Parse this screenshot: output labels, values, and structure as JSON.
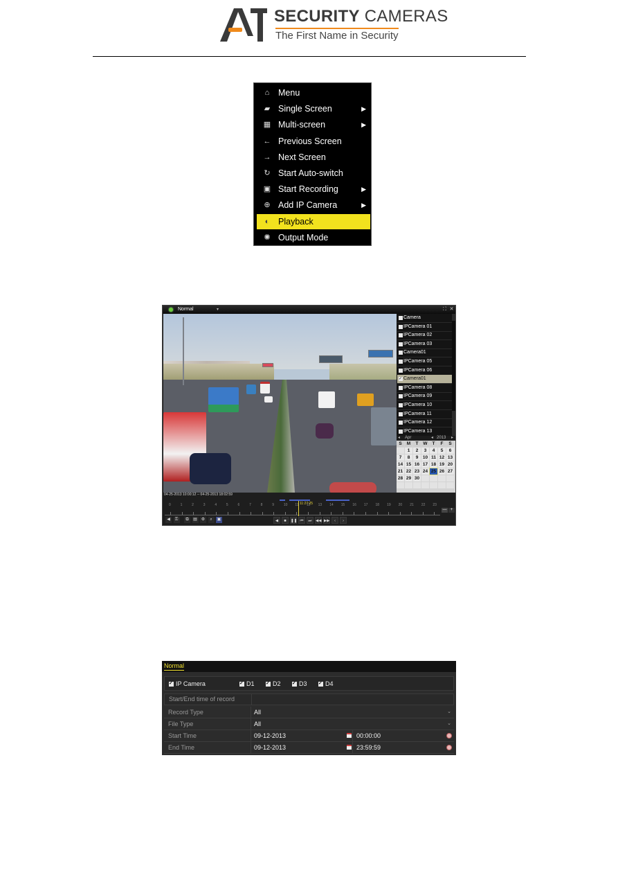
{
  "header": {
    "brand_a1": "A1",
    "brand_title_bold": "SECURITY",
    "brand_title_light": " CAMERAS",
    "tagline": "The First Name in Security",
    "accent_color": "#f08a1c"
  },
  "context_menu": {
    "items": [
      {
        "icon": "home-icon",
        "glyph": "⌂",
        "label": "Menu",
        "submenu": false,
        "selected": false
      },
      {
        "icon": "camera-icon",
        "glyph": "▰",
        "label": "Single Screen",
        "submenu": true,
        "selected": false
      },
      {
        "icon": "multi-screen-icon",
        "glyph": "▦",
        "label": "Multi-screen",
        "submenu": true,
        "selected": false
      },
      {
        "icon": "arrow-left-icon",
        "glyph": "←",
        "label": "Previous Screen",
        "submenu": false,
        "selected": false
      },
      {
        "icon": "arrow-right-icon",
        "glyph": "→",
        "label": "Next Screen",
        "submenu": false,
        "selected": false
      },
      {
        "icon": "refresh-icon",
        "glyph": "↻",
        "label": "Start Auto-switch",
        "submenu": false,
        "selected": false
      },
      {
        "icon": "record-icon",
        "glyph": "▣",
        "label": "Start Recording",
        "submenu": true,
        "selected": false
      },
      {
        "icon": "add-camera-icon",
        "glyph": "⊕",
        "label": "Add IP Camera",
        "submenu": true,
        "selected": false
      },
      {
        "icon": "playback-icon",
        "glyph": "◐",
        "label": "Playback",
        "submenu": false,
        "selected": true
      },
      {
        "icon": "output-mode-icon",
        "glyph": "✺",
        "label": "Output Mode",
        "submenu": false,
        "selected": false
      }
    ],
    "highlight_color": "#f2e21e"
  },
  "playback": {
    "mode": "Normal",
    "cameras": [
      {
        "name": "Camera",
        "checked": false,
        "selected": false
      },
      {
        "name": "IPCamera 01",
        "checked": false,
        "selected": false
      },
      {
        "name": "IPCamera 02",
        "checked": false,
        "selected": false
      },
      {
        "name": "IPCamera 03",
        "checked": false,
        "selected": false
      },
      {
        "name": "Camera01",
        "checked": false,
        "selected": false
      },
      {
        "name": "IPCamera 05",
        "checked": false,
        "selected": false
      },
      {
        "name": "IPCamera 06",
        "checked": false,
        "selected": false
      },
      {
        "name": "Camera01",
        "checked": true,
        "selected": true
      },
      {
        "name": "IPCamera 08",
        "checked": false,
        "selected": false
      },
      {
        "name": "IPCamera 09",
        "checked": false,
        "selected": false
      },
      {
        "name": "IPCamera 10",
        "checked": false,
        "selected": false
      },
      {
        "name": "IPCamera 11",
        "checked": false,
        "selected": false
      },
      {
        "name": "IPCamera 12",
        "checked": false,
        "selected": false
      },
      {
        "name": "IPCamera 13",
        "checked": false,
        "selected": false
      }
    ],
    "calendar": {
      "month": "Apr",
      "year": "2013",
      "weekdays": [
        "S",
        "M",
        "T",
        "W",
        "T",
        "F",
        "S"
      ],
      "leading_blanks": 1,
      "days_in_month": 30,
      "recorded_days": [
        25
      ]
    },
    "time_range": "04-25-2013 10:00:12 -- 04-25-2013 18:02:59",
    "current_time": "11:27:25",
    "ruler_hours": [
      "0",
      "1",
      "2",
      "3",
      "4",
      "5",
      "6",
      "7",
      "8",
      "9",
      "10",
      "11",
      "12",
      "13",
      "14",
      "15",
      "16",
      "17",
      "18",
      "19",
      "20",
      "21",
      "22",
      "23"
    ],
    "toolbar_icons": [
      {
        "name": "audio-icon",
        "glyph": "◀"
      },
      {
        "name": "lock-icon",
        "glyph": "⚿"
      },
      {
        "name": "clip-start-icon",
        "glyph": "⧉"
      },
      {
        "name": "clip-save-icon",
        "glyph": "▤"
      },
      {
        "name": "tag-icon",
        "glyph": "⚙"
      },
      {
        "name": "zoom-icon",
        "glyph": "⌕"
      },
      {
        "name": "snapshot-icon",
        "glyph": "▣"
      }
    ],
    "controls": [
      {
        "name": "reverse-play-icon",
        "glyph": "◀"
      },
      {
        "name": "stop-icon",
        "glyph": "■"
      },
      {
        "name": "pause-icon",
        "glyph": "❚❚"
      },
      {
        "name": "frame-back-icon",
        "glyph": "⏮"
      },
      {
        "name": "frame-forward-icon",
        "glyph": "⏭"
      },
      {
        "name": "slow-icon",
        "glyph": "◀◀"
      },
      {
        "name": "fast-icon",
        "glyph": "▶▶"
      },
      {
        "name": "prev-day-icon",
        "glyph": "‹"
      },
      {
        "name": "next-day-icon",
        "glyph": "›"
      }
    ],
    "zoom_buttons": [
      "—",
      "+"
    ]
  },
  "search": {
    "tab": "Normal",
    "ip_camera_label": "IP Camera",
    "channels": [
      "D1",
      "D2",
      "D3",
      "D4"
    ],
    "start_end_label": "Start/End time of record",
    "rows": [
      {
        "label": "Record Type",
        "value": "All"
      },
      {
        "label": "File Type",
        "value": "All"
      }
    ],
    "start": {
      "label": "Start Time",
      "date": "09-12-2013",
      "time": "00:00:00"
    },
    "end": {
      "label": "End Time",
      "date": "09-12-2013",
      "time": "23:59:59"
    }
  }
}
